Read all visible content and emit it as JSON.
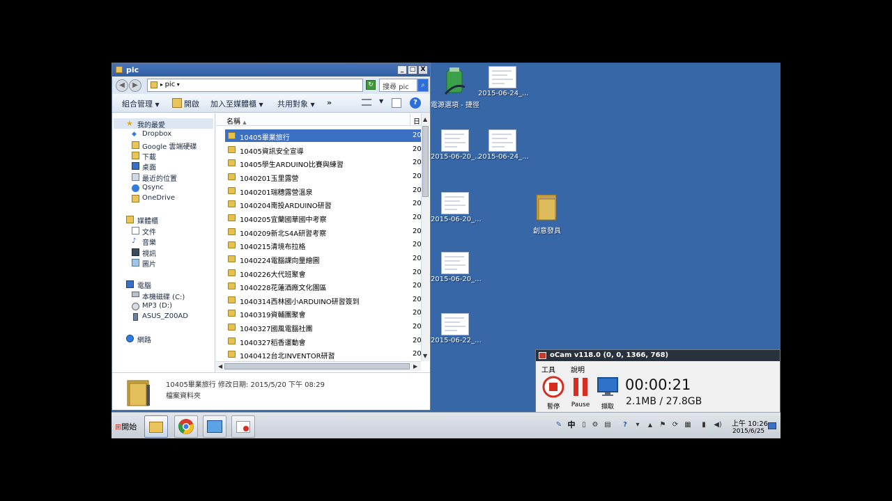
{
  "explorer": {
    "title": "pic",
    "minimize": "_",
    "maximize": "□",
    "close": "X",
    "address": "pic",
    "search_placeholder": "搜尋 pic",
    "toolbar": {
      "organize": "組合管理",
      "open": "開啟",
      "add_to_library": "加入至媒體櫃",
      "share": "共用對象",
      "more": "»"
    },
    "nav": {
      "favorites": "我的最愛",
      "favorites_items": [
        "Dropbox",
        "Google 雲端硬碟",
        "下載",
        "桌面",
        "最近的位置",
        "Qsync",
        "OneDrive"
      ],
      "libraries": "媒體櫃",
      "libraries_items": [
        "文件",
        "音樂",
        "視訊",
        "圖片"
      ],
      "computer": "電腦",
      "computer_items": [
        "本機磁碟 (C:)",
        "MP3 (D:)",
        "ASUS_Z00AD"
      ],
      "network": "網路"
    },
    "columns": {
      "name": "名稱",
      "date": "日"
    },
    "files": [
      {
        "name": "10405畢業旅行",
        "date": "20",
        "selected": true
      },
      {
        "name": "10405資訊安全宣導",
        "date": "20"
      },
      {
        "name": "10405學生ARDUINO比賽與練習",
        "date": "20"
      },
      {
        "name": "1040201玉里露營",
        "date": "20"
      },
      {
        "name": "1040201瑞穗露營溫泉",
        "date": "20"
      },
      {
        "name": "1040204南投ARDUINO研習",
        "date": "20"
      },
      {
        "name": "1040205宜蘭國華國中考察",
        "date": "20"
      },
      {
        "name": "1040209新北S4A研習考察",
        "date": "20"
      },
      {
        "name": "1040215清境布拉格",
        "date": "20"
      },
      {
        "name": "1040224電腦課向量繪圖",
        "date": "20"
      },
      {
        "name": "1040226大代班聚會",
        "date": "20"
      },
      {
        "name": "1040228花蓮酒廠文化園區",
        "date": "20"
      },
      {
        "name": "1040314西林國小ARDUINO研習簽到",
        "date": "20"
      },
      {
        "name": "1040319資輔團聚會",
        "date": "20"
      },
      {
        "name": "1040327國風電腦社團",
        "date": "20"
      },
      {
        "name": "1040327稻香運動會",
        "date": "20"
      },
      {
        "name": "1040412台北INVENTOR研習",
        "date": "20"
      }
    ],
    "details": {
      "line1": "10405畢業旅行  修改日期: 2015/5/20 下午 08:29",
      "line2": "檔案資料夾"
    }
  },
  "desktop": {
    "icons": [
      {
        "label": "電源選項 - 捷徑",
        "kind": "power"
      },
      {
        "label": "2015-06-24_...",
        "kind": "thumb"
      },
      {
        "label": "2015-06-20_...",
        "kind": "thumb"
      },
      {
        "label": "2015-06-24_...",
        "kind": "thumb"
      },
      {
        "label": "2015-06-20_...",
        "kind": "thumb"
      },
      {
        "label": "創意發具",
        "kind": "folder"
      },
      {
        "label": "2015-06-20_...",
        "kind": "thumb"
      },
      {
        "label": "2015-06-22_...",
        "kind": "thumb"
      }
    ]
  },
  "ocam": {
    "title": "oCam v118.0 (0, 0, 1366, 768)",
    "menu_tools": "工具",
    "menu_help": "說明",
    "btn_stop": "暫停",
    "btn_pause": "Pause",
    "btn_capture": "擷取",
    "timer": "00:00:21",
    "size": "2.1MB / 27.8GB"
  },
  "taskbar": {
    "start": "開始",
    "ime": "中",
    "clock_time": "上午 10:26",
    "clock_date": "2015/6/25"
  },
  "colors": {
    "desktop": "#3867a8",
    "selection": "#3a6fc4",
    "titlebar": "#2f5ea6",
    "record_red": "#d62d20"
  }
}
